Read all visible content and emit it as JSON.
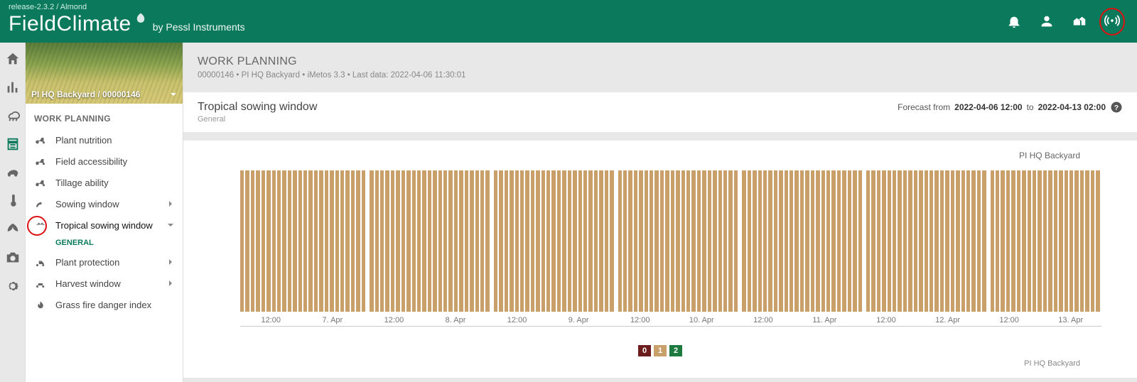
{
  "release_tag": "release-2.3.2 / Almond",
  "brand": {
    "main": "FieldClimate",
    "sub": "by Pessl Instruments"
  },
  "station": {
    "label": "PI HQ Backyard / 00000146"
  },
  "side_heading": "WORK PLANNING",
  "nav": {
    "plant_nutrition": "Plant nutrition",
    "field_accessibility": "Field accessibility",
    "tillage_ability": "Tillage ability",
    "sowing_window": "Sowing window",
    "tropical_sowing": "Tropical sowing window",
    "general_sub": "GENERAL",
    "plant_protection": "Plant protection",
    "harvest_window": "Harvest window",
    "grass_fire": "Grass fire danger index"
  },
  "page": {
    "title": "WORK PLANNING",
    "crumbs": "00000146 • PI HQ Backyard • iMetos 3.3 • Last data: 2022-04-06 11:30:01"
  },
  "card": {
    "title": "Tropical sowing window",
    "sub": "General",
    "forecast_prefix": "Forecast from",
    "forecast_from": "2022-04-06 12:00",
    "forecast_to_word": "to",
    "forecast_to": "2022-04-13 02:00"
  },
  "chart_station": "PI HQ Backyard",
  "legend": {
    "a": "0",
    "b": "1",
    "c": "2"
  },
  "chart_data": {
    "type": "bar",
    "title": "PI HQ Backyard",
    "series_name": "Tropical sowing window — General",
    "categorical_scale": [
      0,
      1,
      2
    ],
    "uniform_value": 1,
    "bar_count": 160,
    "x_start": "2022-04-06 12:00",
    "x_end": "2022-04-13 02:00",
    "x_ticks": [
      "12:00",
      "7. Apr",
      "12:00",
      "8. Apr",
      "12:00",
      "9. Apr",
      "12:00",
      "10. Apr",
      "12:00",
      "11. Apr",
      "12:00",
      "12. Apr",
      "12:00",
      "13. Apr"
    ],
    "ylim": [
      0,
      2
    ],
    "note": "All visible bars share the same height and the same color (category 1 / tan). No bars of category 0 or 2 are visible. Day ticks appear at midnight; '12:00' ticks at noon."
  }
}
